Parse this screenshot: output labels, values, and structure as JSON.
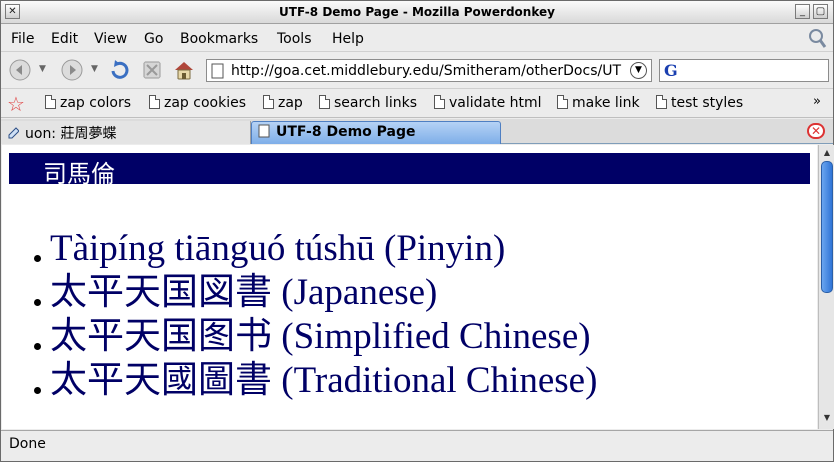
{
  "window": {
    "title": "UTF-8 Demo Page - Mozilla Powerdonkey"
  },
  "menu": [
    "File",
    "Edit",
    "View",
    "Go",
    "Bookmarks",
    "Tools",
    "Help"
  ],
  "navigation": {
    "url": "http://goa.cet.middlebury.edu/Smitheram/otherDocs/UT",
    "search_engine_icon": "G"
  },
  "bookmarks": [
    "zap colors",
    "zap cookies",
    "zap",
    "search links",
    "validate html",
    "make link",
    "test styles"
  ],
  "tabs": [
    {
      "label": "uon: 莊周夢蝶",
      "active": false
    },
    {
      "label": "UTF-8 Demo Page",
      "active": true
    }
  ],
  "page": {
    "heading": "司馬倫",
    "titles": [
      "Tàipíng tiānguó túshū (Pinyin)",
      "太平天国図書 (Japanese)",
      "太平天国图书 (Simplified Chinese)",
      "太平天國圖書 (Traditional Chinese)"
    ]
  },
  "status": {
    "text": "Done"
  },
  "colors": {
    "heading_bg": "#000066",
    "text": "#000066",
    "active_tab": "#8ab6ec"
  }
}
